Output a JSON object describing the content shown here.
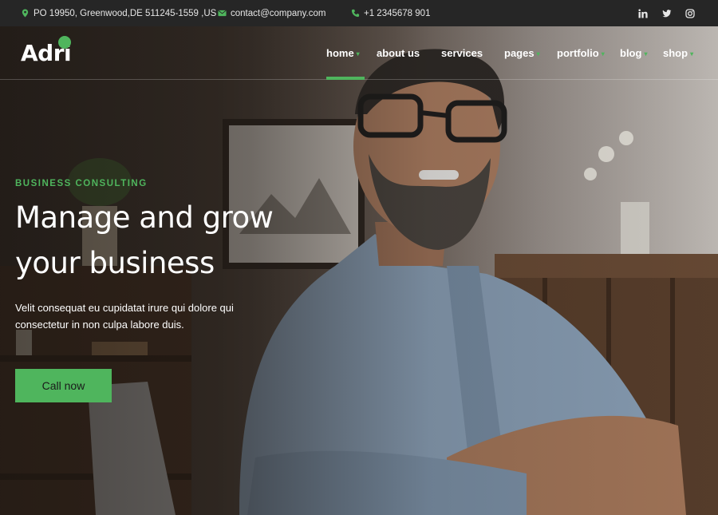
{
  "topbar": {
    "address": "PO 19950, Greenwood,DE 511245-1559 ,US",
    "email": "contact@company.com",
    "phone": "+1 2345678 901",
    "social_icons": [
      "linkedin-icon",
      "twitter-icon",
      "instagram-icon"
    ]
  },
  "logo": {
    "text": "Adri"
  },
  "nav": {
    "items": [
      {
        "label": "home",
        "active": true,
        "has_dropdown": true
      },
      {
        "label": "about us",
        "has_dropdown": false
      },
      {
        "label": "services",
        "has_dropdown": false
      },
      {
        "label": "pages",
        "has_dropdown": true
      },
      {
        "label": "portfolio",
        "has_dropdown": true
      },
      {
        "label": "blog",
        "has_dropdown": true
      },
      {
        "label": "shop",
        "has_dropdown": true
      }
    ]
  },
  "hero": {
    "eyebrow": "BUSINESS CONSULTING",
    "headline_line1_pre": "Manage and ",
    "headline_line1_highlight": "grow",
    "headline_line2_pre": "your ",
    "headline_line2_highlight": "business",
    "paragraph": "Velit consequat eu cupidatat irure qui dolore qui consectetur in non culpa labore duis.",
    "cta_label": "Call now"
  },
  "colors": {
    "accent": "#4fb55d",
    "topbar_bg": "#262626",
    "text_light": "#ffffff"
  }
}
